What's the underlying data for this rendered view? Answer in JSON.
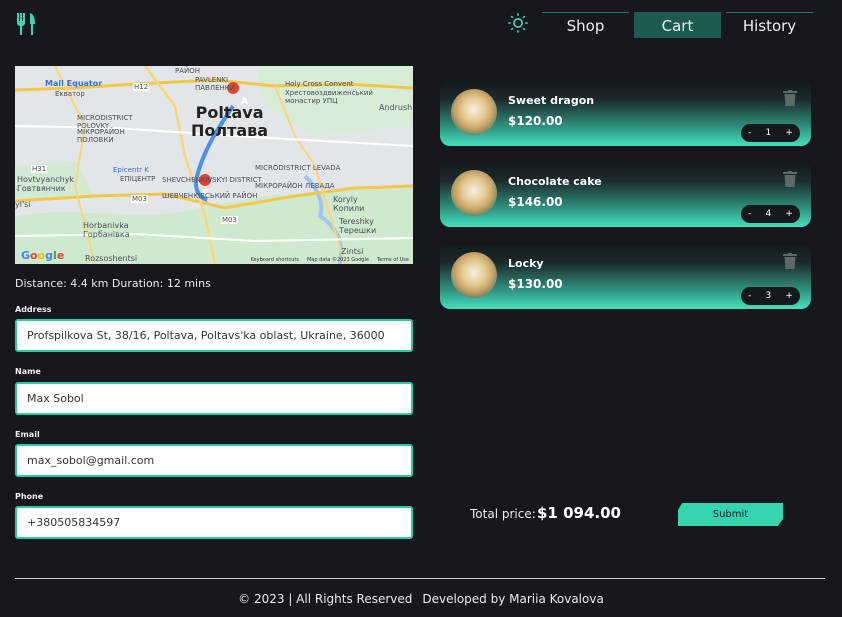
{
  "header": {
    "nav": [
      {
        "label": "Shop",
        "active": false
      },
      {
        "label": "Cart",
        "active": true
      },
      {
        "label": "History",
        "active": false
      }
    ]
  },
  "map": {
    "labels": {
      "city_en": "Poltava",
      "city_ua": "Полтава",
      "mall": "Mall Equator",
      "mall_sub": "Екватор",
      "pavlenky": "PAVLENKI",
      "pavlenky_ua": "ПАВЛЕНКИ",
      "rayon": "РАЙОН",
      "holy_cross": "Holy Cross Convent",
      "holy_cross_ua": "Хрестовоздвиженський монастир УПЦ",
      "polovky": "MICRODISTRICT POLOVKY",
      "polovky_ua": "МІКРОРАЙОН ПОЛОВКИ",
      "epicentr": "Epicentr K",
      "epicentr_ua": "ЕПІЦЕНТР",
      "levada": "MICRODISTRICT LEVADA",
      "levada_ua": "МІКРОРАЙОН ЛЕВАДА",
      "hovtvyanchyk": "Hovtvyanchyk",
      "hovtvyanchyk_ua": "Говтвянчик",
      "shevchenkivskyi": "SHEVCHENKIVSKYI DISTRICT",
      "shevchenkivskyi_ua": "ШЕВЧЕНКІВСЬКИЙ РАЙОН",
      "horbanivka": "Horbanivka",
      "horbanivka_ua": "Горбанівка",
      "koryly": "Koryly",
      "koryly_ua": "Копили",
      "tereshky": "Tereshky",
      "tereshky_ua": "Терешки",
      "zintsi": "Zintsi",
      "rozsoshentsi": "Rozsoshentsi",
      "andrush": "Andrush",
      "yil": "yl'si",
      "road_h12": "H12",
      "road_m03": "M03",
      "road_h31": "H31",
      "marker_a": "A",
      "marker_b": "B"
    },
    "google_logo": "Google",
    "footer": {
      "shortcuts": "Keyboard shortcuts",
      "map_data": "Map data ©2023 Google",
      "terms": "Terms of Use"
    }
  },
  "route": {
    "summary": "Distance: 4.4 km Duration: 12 mins"
  },
  "form": {
    "address_label": "Address",
    "address_value": "Profspilkova St, 38/16, Poltava, Poltavs'ka oblast, Ukraine, 36000",
    "name_label": "Name",
    "name_value": "Max Sobol",
    "email_label": "Email",
    "email_value": "max_sobol@gmail.com",
    "phone_label": "Phone",
    "phone_value": "+380505834597"
  },
  "cart": {
    "items": [
      {
        "name": "Sweet dragon",
        "price": "$120.00",
        "quantity": "1"
      },
      {
        "name": "Chocolate cake",
        "price": "$146.00",
        "quantity": "4"
      },
      {
        "name": "Locky",
        "price": "$130.00",
        "quantity": "3"
      }
    ],
    "minus": "-",
    "plus": "+",
    "total_label": "Total price:",
    "total_value": "$1 094.00",
    "submit_label": "Submit"
  },
  "footer": {
    "copyright": "© 2023 | All Rights Reserved",
    "developer": "Developed by Mariia Kovalova"
  },
  "colors": {
    "background": "#16181d",
    "accent": "#35d4ae",
    "active_tab": "#1f5a52"
  },
  "icons": {
    "logo": "fork-knife-icon",
    "theme": "sun-icon",
    "delete": "trash-icon"
  }
}
